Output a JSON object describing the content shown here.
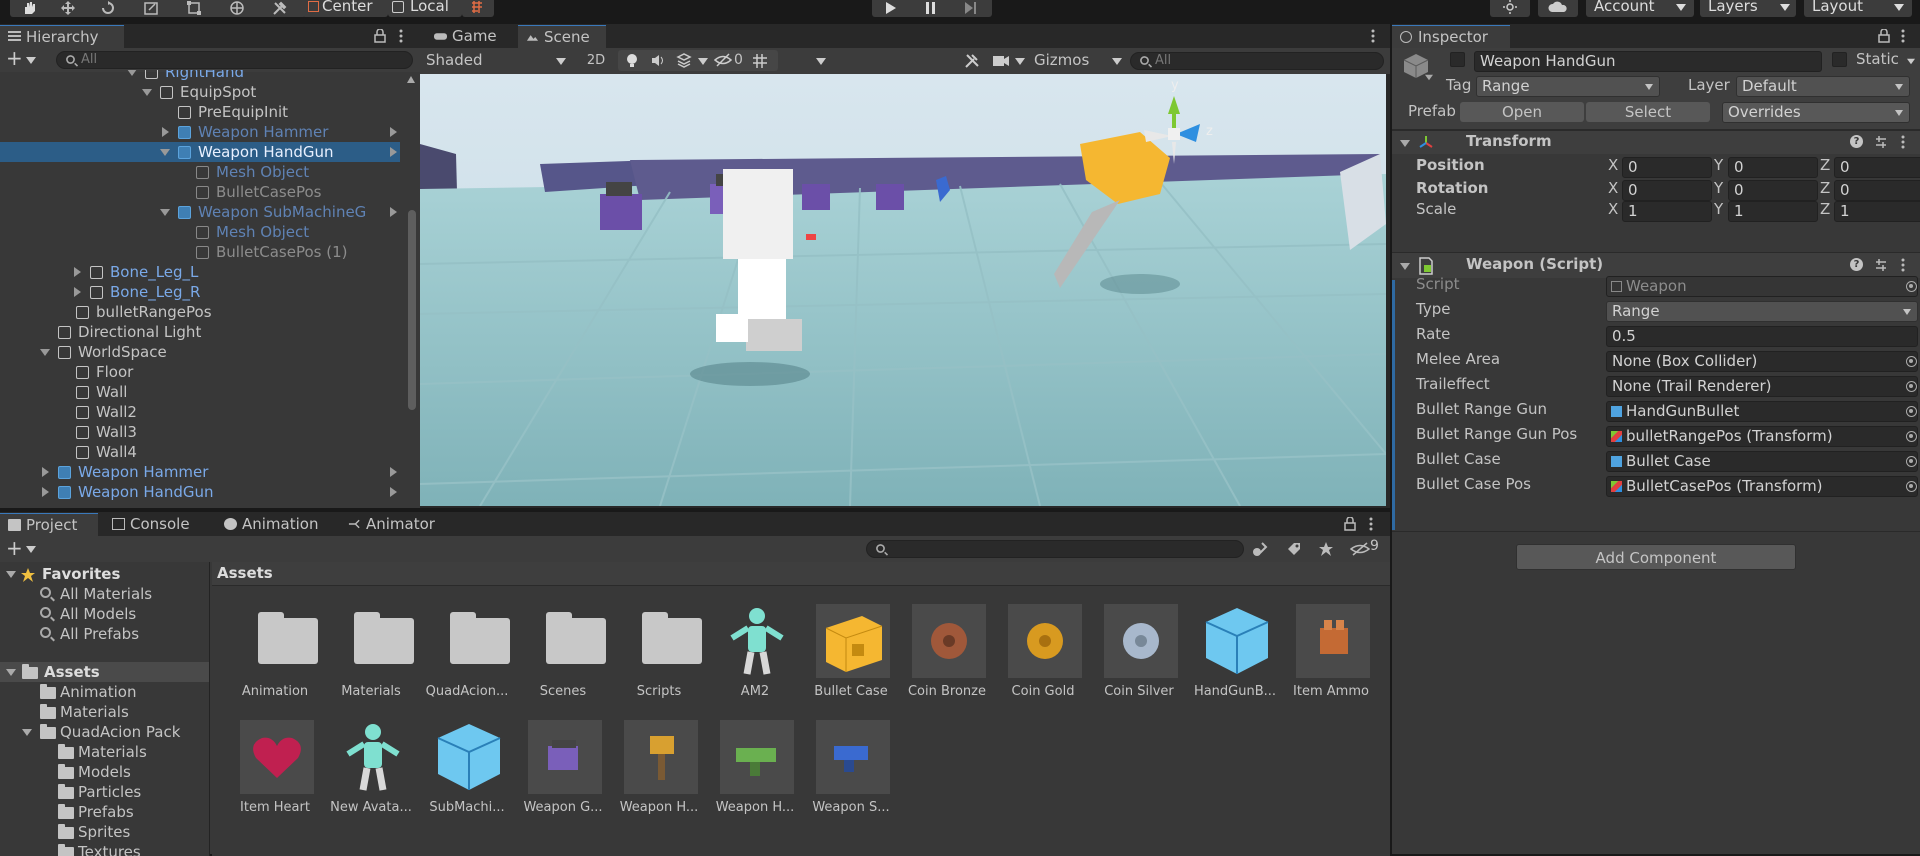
{
  "toolbar": {
    "pivot_label": "Center",
    "space_label": "Local",
    "account_label": "Account",
    "layers_label": "Layers",
    "layout_label": "Layout"
  },
  "hierarchy": {
    "tab_label": "Hierarchy",
    "search_placeholder": "All",
    "rows": [
      {
        "label": "RightHand",
        "style": "blue"
      },
      {
        "label": "EquipSpot",
        "style": "normal"
      },
      {
        "label": "PreEquipInit",
        "style": "normal"
      },
      {
        "label": "Weapon Hammer",
        "style": "dimblue"
      },
      {
        "label": "Weapon HandGun",
        "style": "selected"
      },
      {
        "label": "Mesh Object",
        "style": "dimblue"
      },
      {
        "label": "BulletCasePos",
        "style": "dim"
      },
      {
        "label": "Weapon SubMachineG",
        "style": "dimblue"
      },
      {
        "label": "Mesh Object",
        "style": "dimblue"
      },
      {
        "label": "BulletCasePos (1)",
        "style": "dim"
      },
      {
        "label": "Bone_Leg_L",
        "style": "blue"
      },
      {
        "label": "Bone_Leg_R",
        "style": "blue"
      },
      {
        "label": "bulletRangePos",
        "style": "normal"
      },
      {
        "label": "Directional Light",
        "style": "normal"
      },
      {
        "label": "WorldSpace",
        "style": "normal"
      },
      {
        "label": "Floor",
        "style": "normal"
      },
      {
        "label": "Wall",
        "style": "normal"
      },
      {
        "label": "Wall2",
        "style": "normal"
      },
      {
        "label": "Wall3",
        "style": "normal"
      },
      {
        "label": "Wall4",
        "style": "normal"
      },
      {
        "label": "Weapon Hammer",
        "style": "blue"
      },
      {
        "label": "Weapon HandGun",
        "style": "blue"
      }
    ]
  },
  "scene": {
    "tabs": [
      {
        "label": "Game"
      },
      {
        "label": "Scene"
      }
    ],
    "shading_mode": "Shaded",
    "mode_2d": "2D",
    "hidden_count": "0",
    "gizmos_label": "Gizmos",
    "search_placeholder": "All",
    "axis_y": "y",
    "axis_z": "z"
  },
  "bottom": {
    "tabs": [
      {
        "label": "Project"
      },
      {
        "label": "Console"
      },
      {
        "label": "Animation"
      },
      {
        "label": "Animator"
      }
    ],
    "hidden_packages_count": "9",
    "favorites_label": "Favorites",
    "favorites": [
      "All Materials",
      "All Models",
      "All Prefabs"
    ],
    "assets_root": "Assets",
    "tree": [
      "Animation",
      "Materials",
      "QuadAcion Pack",
      "Materials",
      "Models",
      "Particles",
      "Prefabs",
      "Sprites",
      "Textures"
    ],
    "breadcrumb": "Assets",
    "assets": [
      {
        "name": "Animation",
        "kind": "folder"
      },
      {
        "name": "Materials",
        "kind": "folder"
      },
      {
        "name": "QuadAcion...",
        "kind": "folder"
      },
      {
        "name": "Scenes",
        "kind": "folder"
      },
      {
        "name": "Scripts",
        "kind": "folder"
      },
      {
        "name": "AM2",
        "kind": "avatar"
      },
      {
        "name": "Bullet Case",
        "kind": "cube-yellow"
      },
      {
        "name": "Coin Bronze",
        "kind": "coin-bronze"
      },
      {
        "name": "Coin Gold",
        "kind": "coin-gold"
      },
      {
        "name": "Coin Silver",
        "kind": "coin-silver"
      },
      {
        "name": "HandGunB...",
        "kind": "prefab-cube"
      },
      {
        "name": "Item Ammo",
        "kind": "ammo"
      },
      {
        "name": "Item Heart",
        "kind": "heart"
      },
      {
        "name": "New Avata...",
        "kind": "avatar"
      },
      {
        "name": "SubMachi...",
        "kind": "prefab-cube"
      },
      {
        "name": "Weapon G...",
        "kind": "weapon-purple"
      },
      {
        "name": "Weapon H...",
        "kind": "weapon-hammer"
      },
      {
        "name": "Weapon H...",
        "kind": "weapon-green"
      },
      {
        "name": "Weapon S...",
        "kind": "weapon-blue"
      }
    ]
  },
  "inspector": {
    "tab_label": "Inspector",
    "object_name": "Weapon HandGun",
    "static_label": "Static",
    "tag_label": "Tag",
    "tag_value": "Range",
    "layer_label": "Layer",
    "layer_value": "Default",
    "prefab_label": "Prefab",
    "prefab_open": "Open",
    "prefab_select": "Select",
    "prefab_overrides": "Overrides",
    "transform": {
      "title": "Transform",
      "position_label": "Position",
      "rotation_label": "Rotation",
      "scale_label": "Scale",
      "axis_x": "X",
      "axis_y": "Y",
      "axis_z": "Z",
      "position": [
        "0",
        "0",
        "0"
      ],
      "rotation": [
        "0",
        "0",
        "0"
      ],
      "scale": [
        "1",
        "1",
        "1"
      ]
    },
    "script": {
      "title": "Weapon (Script)",
      "fields": [
        {
          "label": "Script",
          "value": "Weapon",
          "kind": "script"
        },
        {
          "label": "Type",
          "value": "Range",
          "kind": "dropdown"
        },
        {
          "label": "Rate",
          "value": "0.5",
          "kind": "text"
        },
        {
          "label": "Melee Area",
          "value": "None (Box Collider)",
          "kind": "object"
        },
        {
          "label": "Traileffect",
          "value": "None (Trail Renderer)",
          "kind": "object"
        },
        {
          "label": "Bullet Range Gun",
          "value": "HandGunBullet",
          "kind": "prefab"
        },
        {
          "label": "Bullet Range Gun Pos",
          "value": "bulletRangePos (Transform)",
          "kind": "transform"
        },
        {
          "label": "Bullet Case",
          "value": "Bullet Case",
          "kind": "prefab"
        },
        {
          "label": "Bullet Case Pos",
          "value": "BulletCasePos (Transform)",
          "kind": "transform"
        }
      ]
    },
    "add_component": "Add Component"
  }
}
